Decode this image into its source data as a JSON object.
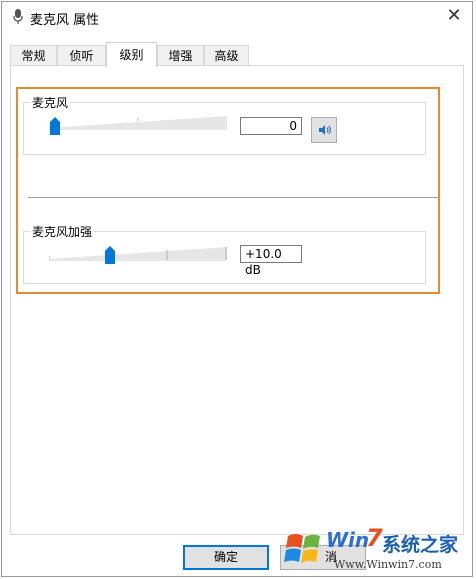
{
  "window": {
    "title": "麦克风 属性",
    "close_symbol": "✕"
  },
  "tabs": [
    {
      "label": "常规",
      "active": false
    },
    {
      "label": "侦听",
      "active": false
    },
    {
      "label": "级别",
      "active": true
    },
    {
      "label": "增强",
      "active": false
    },
    {
      "label": "高级",
      "active": false
    }
  ],
  "microphone": {
    "label": "麦克风",
    "value": "0",
    "level_fraction": 0.0,
    "speaker_icon": "speaker-icon"
  },
  "boost": {
    "label": "麦克风加强",
    "value": "+10.0 dB",
    "level_fraction": 0.33
  },
  "buttons": {
    "ok": "确定",
    "cancel_partial": "消"
  },
  "watermark": {
    "win": "Win",
    "seven": "7",
    "brand": "系统之家",
    "url": "Www.Winwin7.com"
  },
  "colors": {
    "highlight": "#e38a32",
    "thumb": "#0078d7",
    "default_button_border": "#0078d7"
  }
}
